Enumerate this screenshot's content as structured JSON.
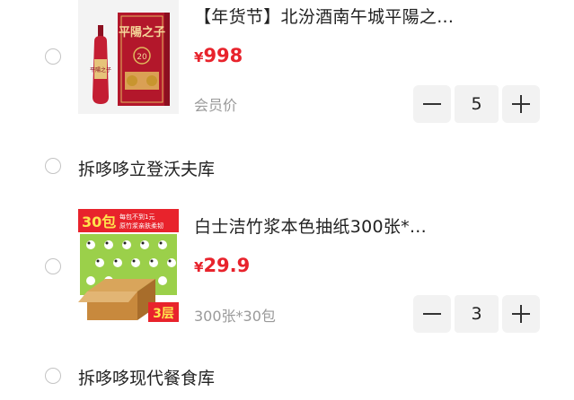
{
  "items": [
    {
      "title": "【年货节】北汾酒南午城平陽之...",
      "currency": "¥",
      "price": "998",
      "spec": "会员价",
      "quantity": "5",
      "thumb_text": {
        "brand": "平陽之子",
        "label": "20",
        "small": "平陽之子"
      }
    },
    {
      "title": "白士洁竹浆本色抽纸300张*...",
      "currency": "¥",
      "price": "29.9",
      "spec": "300张*30包",
      "quantity": "3",
      "thumb_text": {
        "badge": "30包",
        "line1": "每包不到1元",
        "line2": "原竹浆亲肤柔韧",
        "layers": "3层"
      }
    }
  ],
  "stores": [
    {
      "name": "拆哆哆立登沃夫库"
    },
    {
      "name": "拆哆哆现代餐食库"
    }
  ],
  "colors": {
    "price": "#e8232c",
    "wine_red": "#b3172b",
    "gold": "#e0b85c",
    "tissue_green": "#9bd04a"
  }
}
